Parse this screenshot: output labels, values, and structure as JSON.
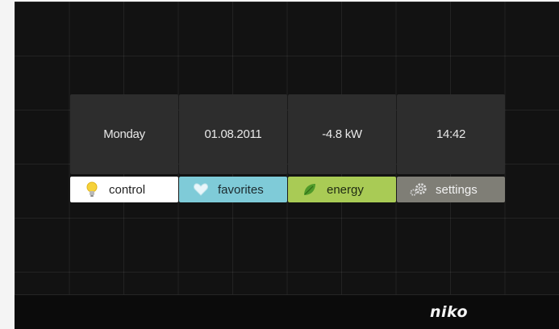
{
  "info_tiles": [
    {
      "label": "Monday"
    },
    {
      "label": "01.08.2011"
    },
    {
      "label": "-4.8 kW"
    },
    {
      "label": "14:42"
    }
  ],
  "tabs": [
    {
      "label": "control",
      "icon": "lightbulb-icon",
      "color": "#ffffff"
    },
    {
      "label": "favorites",
      "icon": "heart-icon",
      "color": "#7fcbd8"
    },
    {
      "label": "energy",
      "icon": "leaf-icon",
      "color": "#a9cb55"
    },
    {
      "label": "settings",
      "icon": "gears-icon",
      "color": "#7f7e76"
    }
  ],
  "brand": {
    "logo": "niko"
  },
  "colors": {
    "background": "#121212",
    "tile": "#2d2d2d"
  }
}
